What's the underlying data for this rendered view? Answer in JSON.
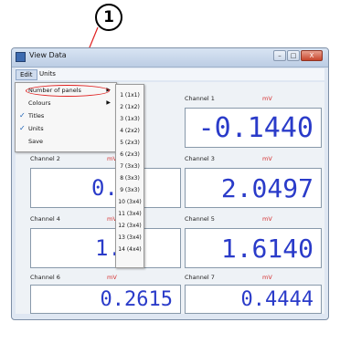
{
  "callout": {
    "number": "1"
  },
  "window": {
    "title": "View Data",
    "buttons": {
      "minimize": "–",
      "maximize": "□",
      "close": "X"
    }
  },
  "menubar": {
    "items": [
      {
        "label": "Edit"
      },
      {
        "label": "Units"
      }
    ]
  },
  "edit_menu": {
    "items": [
      {
        "label": "Number of panels",
        "checked": false,
        "has_submenu": true
      },
      {
        "label": "Colours",
        "checked": false,
        "has_submenu": true
      },
      {
        "label": "Titles",
        "checked": true,
        "has_submenu": false
      },
      {
        "label": "Units",
        "checked": true,
        "has_submenu": false
      },
      {
        "label": "Save",
        "checked": false,
        "has_submenu": false
      }
    ],
    "check_glyph": "✓",
    "arrow_glyph": "▶"
  },
  "panels_submenu": {
    "items": [
      "1 (1x1)",
      "2 (1x2)",
      "3 (1x3)",
      "4 (2x2)",
      "5 (2x3)",
      "6 (2x3)",
      "7 (3x3)",
      "8 (3x3)",
      "9 (3x3)",
      "10 (3x4)",
      "11 (3x4)",
      "12 (3x4)",
      "13 (3x4)",
      "14 (4x4)"
    ]
  },
  "channels": [
    {
      "name": "Channel 1",
      "unit": "mV",
      "value": "-0.1440"
    },
    {
      "name": "Channel 2",
      "unit": "mV",
      "value": "0.0"
    },
    {
      "name": "Channel 3",
      "unit": "mV",
      "value": "2.0497"
    },
    {
      "name": "Channel 4",
      "unit": "mV",
      "value": "1.6"
    },
    {
      "name": "Channel 5",
      "unit": "mV",
      "value": "1.6140"
    },
    {
      "name": "Channel 6",
      "unit": "mV",
      "value": "0.2615"
    },
    {
      "name": "Channel 7",
      "unit": "mV",
      "value": "0.4444"
    }
  ],
  "colors": {
    "value_text": "#2a3bc9",
    "unit_text": "#d63030",
    "highlight": "#e02020"
  }
}
